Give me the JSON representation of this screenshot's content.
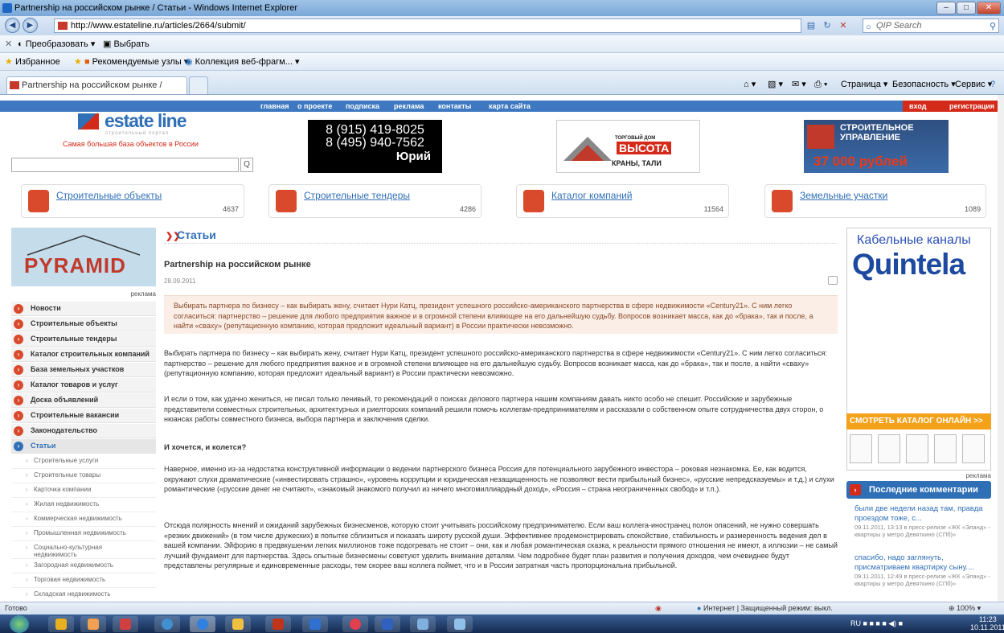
{
  "window": {
    "title": "Partnership на российском рынке / Статьи - Windows Internet Explorer",
    "min": "–",
    "max": "□",
    "close": "✕"
  },
  "address": {
    "url": "http://www.estateline.ru/articles/2664/submit/",
    "search_placeholder": "QIP Search"
  },
  "toolbar": {
    "transform": "Преобразовать",
    "select": "Выбрать"
  },
  "favbar": {
    "favorites": "Избранное",
    "suggested": "Рекомендуемые узлы ▾",
    "gallery": "Коллекция веб-фрагм... ▾"
  },
  "tabs": {
    "active": "Partnership на российском рынке / Статьи"
  },
  "commandbar": {
    "page": "Страница ▾",
    "safety": "Безопасность ▾",
    "tools": "Сервис ▾"
  },
  "site": {
    "nav": [
      "главная",
      "о проекте",
      "подписка",
      "реклама",
      "контакты",
      "карта сайта"
    ],
    "login": "вход",
    "register": "регистрация",
    "logo": "estate line",
    "logo_sub": "строительный портал",
    "tagline": "Самая большая база объектов в России",
    "search_button": "Q"
  },
  "banners": {
    "phone1": "8 (915) 419-8025",
    "phone2": "8 (495) 940-7562",
    "name": "Юрий",
    "vysota_small": "ТОРГОВЫЙ ДОМ",
    "vysota_logo": "ВЫСОТА",
    "vysota_text": "КРАНЫ, ТАЛИ",
    "stroy_line1": "СТРОИТЕЛЬНОЕ",
    "stroy_line2": "УПРАВЛЕНИЕ",
    "stroy_price": "37 000 рублей"
  },
  "categories": [
    {
      "label": "Строительные объекты",
      "count": "4637"
    },
    {
      "label": "Строительные тендеры",
      "count": "4286"
    },
    {
      "label": "Каталог компаний",
      "count": "11564"
    },
    {
      "label": "Земельные участки",
      "count": "1089"
    }
  ],
  "left": {
    "pyramid": "PYRAMID",
    "reklama": "реклама",
    "menu": [
      "Новости",
      "Строительные объекты",
      "Строительные тендеры",
      "Каталог строительных компаний",
      "База земельных участков",
      "Каталог товаров и услуг",
      "Доска объявлений",
      "Строительные вакансии",
      "Законодательство",
      "Статьи"
    ],
    "sub": [
      "Строительные услуги",
      "Строительные товары",
      "Карточка компании",
      "Жилая недвижимость",
      "Коммерческая недвижимость",
      "Промышленная недвижимость",
      "Социально-культурная недвижимость",
      "Загородная недвижимость",
      "Торговая недвижимость",
      "Складская недвижимость"
    ],
    "sub_marker": "›"
  },
  "article": {
    "section": "Статьи",
    "section_arrow": "❯❯",
    "title": "Partnership на российском рынке",
    "date": "28.09.2011",
    "lead": "Выбирать партнера по бизнесу – как выбирать жену, считает Нури Катц, президент успешного российско-американского партнерства в сфере недвижимости «Century21». С ним легко согласиться: партнерство – решение для любого предприятия важное и в огромной степени влияющее на его дальнейшую судьбу. Вопросов возникает масса, как до «брака», так и после, а найти «сваху» (репутационную компанию, которая предложит идеальный вариант) в России практически невозможно.",
    "p1": "Выбирать партнера по бизнесу – как выбирать жену, считает Нури Катц, президент успешного российско-американского партнерства в сфере недвижимости «Century21». С ним легко согласиться: партнерство – решение для любого предприятия важное и в огромной степени влияющее на его дальнейшую судьбу. Вопросов возникает масса, как до «брака», так и после, а найти «сваху» (репутационную компанию, которая предложит идеальный вариант) в России практически невозможно.",
    "p2": "И если о том, как удачно жениться, не писал только ленивый, то рекомендаций о поисках делового партнера нашим компаниям давать никто особо не спешит. Российские и зарубежные представители совместных строительных, архитектурных и риелторских компаний решили помочь коллегам-предпринимателям и рассказали о собственном опыте сотрудничества двух сторон, о нюансах работы совместного бизнеса, выбора партнера и заключения сделки.",
    "subhead": "И хочется, и колется?",
    "p3": "Наверное, именно из-за недостатка конструктивной информации о ведении партнерского бизнеса Россия для потенциального зарубежного инвестора – роковая незнакомка. Ее, как водится, окружают слухи драматические («инвестировать страшно», «уровень коррупции и юридическая незащищенность не позволяют вести прибыльный бизнес», «русские непредсказуемы» и т.д.) и слухи романтические («русские денег не считают», «знакомый знакомого получил из ничего многомиллиардный доход», «Россия – страна неограниченных свобод» и т.п.).",
    "p4": "Отсюда полярность мнений и ожиданий зарубежных бизнесменов, которую стоит учитывать российскому предпринимателю. Если ваш коллега-иностранец полон опасений, не нужно совершать «резких движений» (в том числе дружеских) в попытке сблизиться и показать широту русской души. Эффективнее продемонстрировать спокойствие, стабильность и размеренность ведения дел в вашей компании. Эйфорию в предвкушении легких миллионов тоже подогревать не стоит – они, как и любая романтическая сказка, к реальности прямого отношения не имеют, а иллюзии – не самый лучший фундамент для партнерства. Здесь опытные бизнесмены советуют уделить внимание деталям. Чем подробнее будет план развития и получения доходов, чем очевиднее будут представлены регулярные и единовременные расходы, тем скорее ваш коллега поймет, что и в России затратная часть пропорциональна прибыльной."
  },
  "right": {
    "ad1": "Кабельные каналы",
    "ad2": "Quintela",
    "catalog": "СМОТРЕТЬ КАТАЛОГ ОНЛАЙН >>",
    "reklama": "реклама",
    "comments_title": "Последние комментарии",
    "comments": [
      {
        "text": "были две недели назад там, правда проездом тоже, с...",
        "meta": "09.11.2011, 13:13 в пресс-релизе «ЖК «Эланд» - квартиры у метро Девяткино (СПб)»"
      },
      {
        "text": "спасибо, надо заглянуть, присматриваем квартирку сыну....",
        "meta": "09.11.2011, 12:49 в пресс-релизе «ЖК «Эланд» - квартиры у метро Девяткино (СПб)»"
      }
    ]
  },
  "status": {
    "ready": "Готово",
    "zone": "Интернет | Защищенный режим: выкл.",
    "zoom": "100%"
  },
  "taskbar": {
    "lang": "RU",
    "time": "11:23",
    "date": "10.11.2011"
  },
  "colors": {
    "blue": "#2f6fb6",
    "red": "#d42a1a",
    "nav": "#3d78c0",
    "orange": "#f4a21a"
  }
}
